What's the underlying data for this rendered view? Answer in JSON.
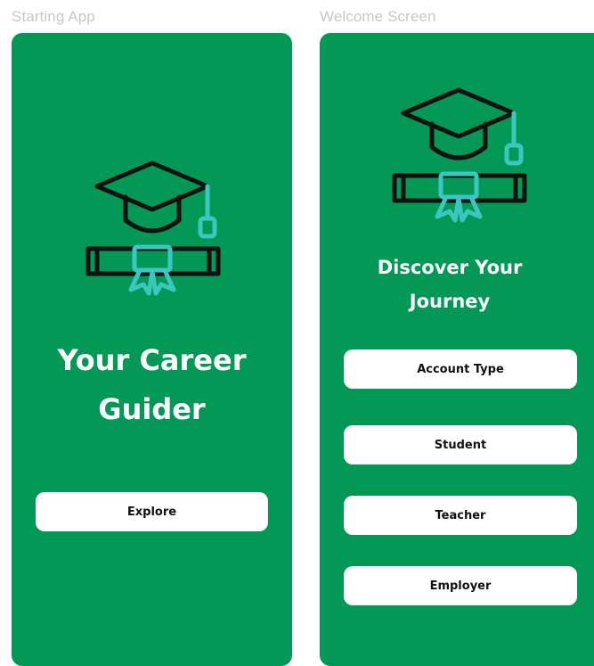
{
  "frames": {
    "starting_label": "Starting App",
    "welcome_label": "Welcome Screen"
  },
  "starting_screen": {
    "logo_icon": "graduation-cap-diploma-icon",
    "title": "Your Career\nGuider",
    "explore_label": "Explore"
  },
  "welcome_screen": {
    "logo_icon": "graduation-cap-diploma-icon",
    "title": "Discover Your\nJourney",
    "buttons": {
      "account_type": "Account Type",
      "student": "Student",
      "teacher": "Teacher",
      "employer": "Employer"
    }
  },
  "colors": {
    "screen_background": "#039855",
    "logo_stroke": "#111111",
    "logo_accent": "#3cc6c0",
    "button_background": "#ffffff",
    "frame_label": "#c8c8c8"
  }
}
